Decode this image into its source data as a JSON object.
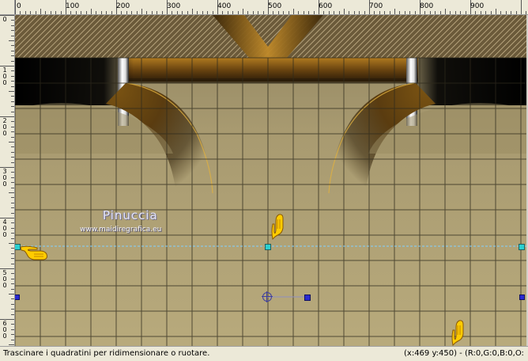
{
  "ruler": {
    "top_labels": [
      "0",
      "100",
      "200",
      "300",
      "400",
      "500",
      "600",
      "700",
      "800",
      "900"
    ],
    "left_labels": [
      "0",
      "100",
      "200",
      "300",
      "400",
      "500",
      "600"
    ]
  },
  "canvas": {
    "background": "#b3a577",
    "grid_color": "#2e2a1c",
    "guide_color": "#7fd0ff"
  },
  "watermark": {
    "name": "Pinuccia",
    "url": "www.maidiregrafica.eu"
  },
  "statusbar": {
    "message": "Trascinare i quadratini per ridimensionare o ruotare.",
    "coords": "(x:469 y:450) - (R:0,G:0,B:0,O:"
  },
  "icons": [
    "pointing-hand-icon",
    "handle-icon",
    "rotation-pivot-icon"
  ]
}
